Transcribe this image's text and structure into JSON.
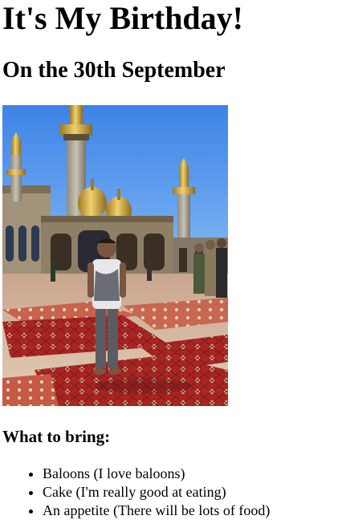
{
  "page": {
    "title": "It's My Birthday!",
    "date_line": "On the 30th September",
    "photo": {
      "icon": "photo-image"
    },
    "bring_section": {
      "heading": "What to bring:",
      "items": [
        {
          "label": "Baloons (I love baloons)"
        },
        {
          "label": "Cake (I'm really good at eating)"
        },
        {
          "label": "An appetite (There will be lots of food)"
        }
      ]
    }
  }
}
